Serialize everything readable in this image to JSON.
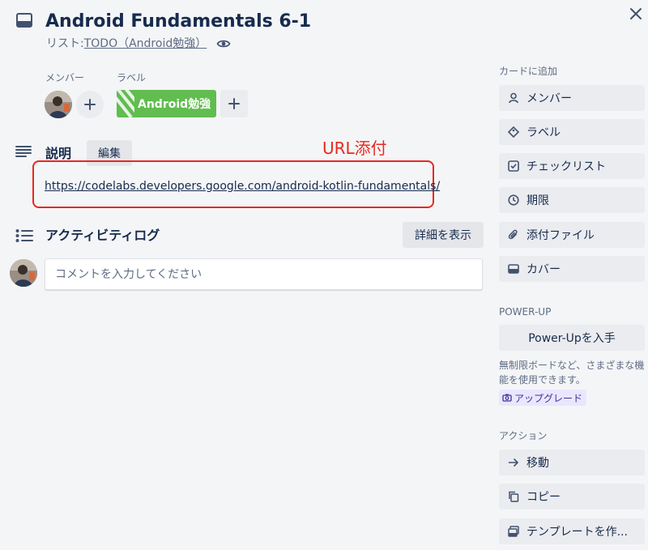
{
  "card": {
    "title": "Android Fundamentals 6-1",
    "list_prefix": "リスト: ",
    "list_name": "TODO（Android勉強）"
  },
  "members": {
    "label": "メンバー"
  },
  "labels": {
    "label": "ラベル",
    "items": [
      {
        "text": "Android勉強",
        "color": "#61bd4f"
      }
    ]
  },
  "description": {
    "title": "説明",
    "edit_label": "編集",
    "link": "https://codelabs.developers.google.com/android-kotlin-fundamentals/",
    "annotation": "URL添付",
    "annotation_color": "#e8281f"
  },
  "activity": {
    "title": "アクティビティログ",
    "details_label": "詳細を表示",
    "comment_placeholder": "コメントを入力してください"
  },
  "sidebar": {
    "add_to_card_heading": "カードに追加",
    "add_buttons": [
      {
        "label": "メンバー",
        "icon": "person-icon"
      },
      {
        "label": "ラベル",
        "icon": "tag-icon"
      },
      {
        "label": "チェックリスト",
        "icon": "checkbox-icon"
      },
      {
        "label": "期限",
        "icon": "clock-icon"
      },
      {
        "label": "添付ファイル",
        "icon": "paperclip-icon"
      },
      {
        "label": "カバー",
        "icon": "card-cover-icon"
      }
    ],
    "powerup_heading": "POWER-UP",
    "powerup_button": "Power-Upを入手",
    "powerup_desc": "無制限ボードなど、さまざまな機能を使用できます。",
    "upgrade_label": "アップグレード",
    "actions_heading": "アクション",
    "action_buttons": [
      {
        "label": "移動",
        "icon": "arrow-right-icon"
      },
      {
        "label": "コピー",
        "icon": "copy-icon"
      },
      {
        "label": "テンプレートを作...",
        "icon": "template-icon"
      }
    ]
  },
  "colors": {
    "background": "#f4f5f7",
    "text": "#172b4d",
    "muted": "#5e6c84",
    "button_bg": "#ebecf0",
    "upgrade_bg": "#eae6ff"
  }
}
